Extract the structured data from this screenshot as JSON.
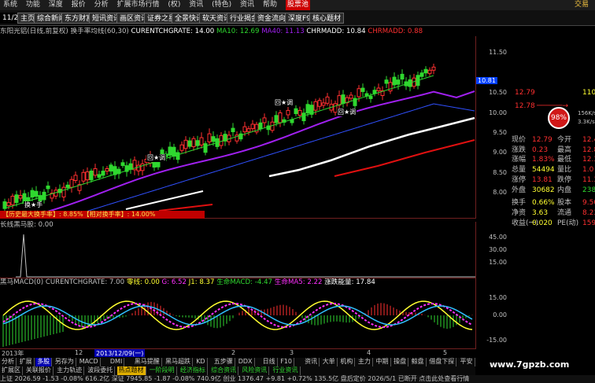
{
  "menu": [
    "系统",
    "功能",
    "深度",
    "报价",
    "分析",
    "扩展市场行情",
    "(权)",
    "资讯",
    "(特色)",
    "资讯",
    "帮助",
    "股票池"
  ],
  "menu_right": "交易",
  "toolbar": [
    "11/2",
    "主页",
    "综合新闻",
    "东方财富",
    "短讯资讯",
    "画区资讯",
    "证券之星",
    "全景快讯",
    "软天资讯",
    "行业揭金",
    "资金流向",
    "深度F9",
    "核心题材"
  ],
  "main_info": {
    "title": "东阳光铝(日线,前复权) 换手率均线(60,30)",
    "curentchgrate": "CURENTCHGRATE: 14.00",
    "ma10": "MA10: 12.69",
    "ma40": "MA40: 11.13",
    "chrmadd": "CHRMADD: 10.84",
    "chrmadd2": "CHRMADD: 0.88"
  },
  "history_bar": "【历史最大换手率】: 8.85%【相对换手率】: 14.00%",
  "annotations": {
    "n1": "换★手",
    "n2": "回★调",
    "n3": "回★调",
    "n4": "回★调"
  },
  "axis1": [
    "11.50",
    "11.00",
    "10.50",
    "10.00",
    "9.50",
    "9.00",
    "8.50",
    "8.00"
  ],
  "price_tag": "10.81",
  "vol_info": "长线黑马股: 0.00",
  "axis2": [
    "45.00",
    "30.00",
    "15.00"
  ],
  "macd_info": {
    "title": "黑马MACD(0) CURENTCHGRATE: 7.00",
    "zero": "零线: 0.00",
    "g": "G: 6.52",
    "j1": "J1: 8.37",
    "life": "生命MACD: -4.47",
    "lifema": "生命MA5: 2.22",
    "energy": "涨跌能量: 17.84"
  },
  "axis3": [
    "15.00",
    "0.00",
    "-15.00"
  ],
  "time_axis": [
    "2013年",
    "12",
    "2013/12/09(一)",
    "2",
    "3",
    "4",
    "5"
  ],
  "tabs1": [
    "分析",
    "扩展",
    "多股",
    "另存为",
    "MACD",
    "DMI",
    "黑马提醒",
    "黑马超跌",
    "KD",
    "五步骤",
    "DDX",
    "日线",
    "F10",
    "资讯",
    "大单",
    "机构",
    "主力",
    "中期",
    "操盘",
    "鲸盘",
    "借盘下探",
    "平安",
    "凤凰理念",
    "长线黑马"
  ],
  "tabs2": [
    "扩展区",
    "关联报价",
    "主力轨迹",
    "波段委托",
    "热点题材",
    "一阶段明",
    "经济指标",
    "综合资讯",
    "风险资讯",
    "行业资讯"
  ],
  "status": "上证 2026.59  -1.53  -0.08%  616.2亿  深证 7945.85  -1.87  -0.08%  740.9亿  创业 1376.47  +9.81  +0.72%  135.5亿  盘后定价  2026/5/1  已断开  点击此处查看行情",
  "order": {
    "sell": "12.79",
    "sell_vol": "110",
    "buy": "12.78",
    "buy_vol": "",
    "bubble": "98%",
    "speed1": "156K/s",
    "speed2": "3.3K/s"
  },
  "quote": [
    {
      "l": "现价",
      "v": "12.79",
      "l2": "今开",
      "v2": "12.4"
    },
    {
      "l": "涨跌",
      "v": "0.23",
      "l2": "最高",
      "v2": "12.8"
    },
    {
      "l": "涨幅",
      "v": "1.83%",
      "l2": "最低",
      "v2": "12.3"
    },
    {
      "l": "总量",
      "v": "54494",
      "l2": "量比",
      "v2": "1.0"
    },
    {
      "l": "涨停",
      "v": "13.81",
      "l2": "跌停",
      "v2": "11.3"
    },
    {
      "l": "外盘",
      "v": "30682",
      "l2": "内盘",
      "v2": "2381"
    },
    {
      "l": "换手",
      "v": "0.66%",
      "l2": "股本",
      "v2": "9.50"
    },
    {
      "l": "净资",
      "v": "3.63",
      "l2": "流通",
      "v2": "8.23"
    },
    {
      "l": "收益(一)",
      "v": "0.020",
      "l2": "PE(动)",
      "v2": "159"
    }
  ],
  "watermark": "www.7gpzb.com",
  "colors": {
    "up": "#ff3030",
    "down": "#00d8d8",
    "ma10": "#2fd82f",
    "ma40": "#a020f0",
    "white": "#ffffff",
    "red": "#e01010",
    "yellow": "#ffff30",
    "magenta": "#ff30ff",
    "cyan": "#30c0ff",
    "blue": "#3050ff"
  }
}
